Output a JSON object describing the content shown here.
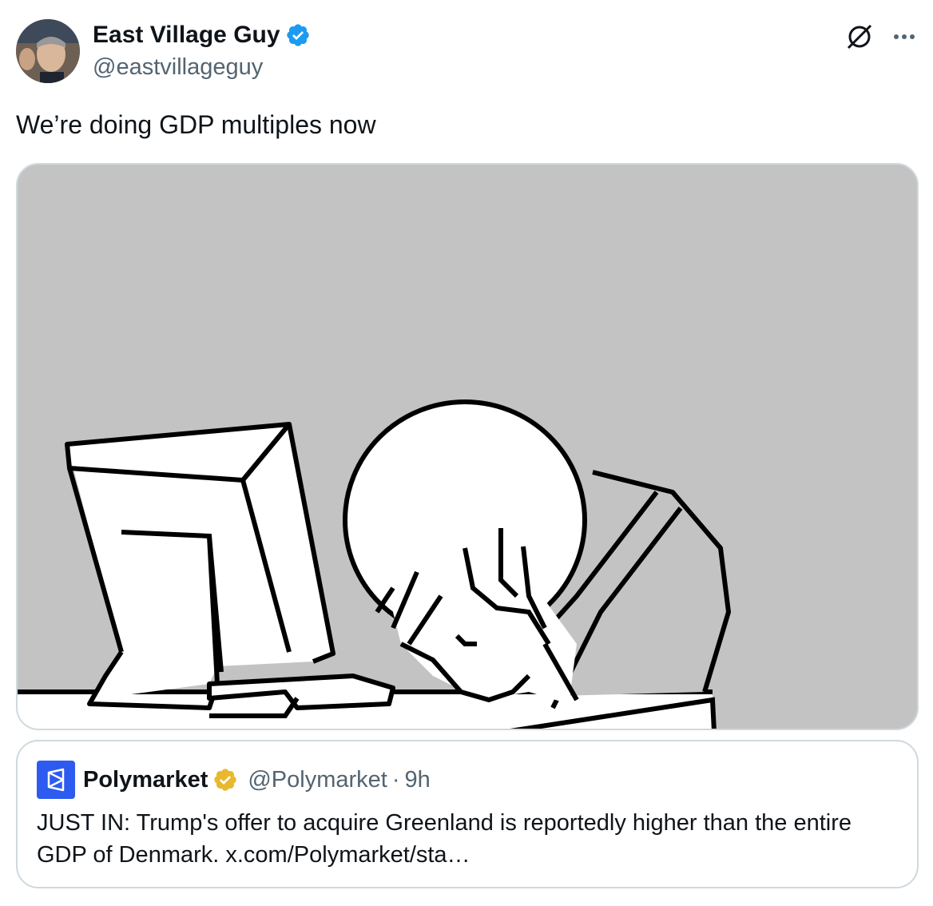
{
  "tweet": {
    "display_name": "East Village Guy",
    "handle": "@eastvillageguy",
    "text": "We’re doing GDP multiples now",
    "verified_color": "#1d9bf0"
  },
  "icons": {
    "avatar": "avatar-photo",
    "verified": "verified-badge-icon",
    "grok": "grok-icon",
    "more": "more-icon"
  },
  "quote": {
    "display_name": "Polymarket",
    "handle": "@Polymarket",
    "separator": "·",
    "time": "9h",
    "text": "JUST IN: Trump's offer to acquire Greenland is reportedly higher than the entire GDP of Denmark. x.com/Polymarket/sta…",
    "logo_color": "#2d5bf0",
    "badge_color": "#e8b82f"
  },
  "media": {
    "description_icon": "meme-image",
    "background_color": "#c3c3c3"
  }
}
